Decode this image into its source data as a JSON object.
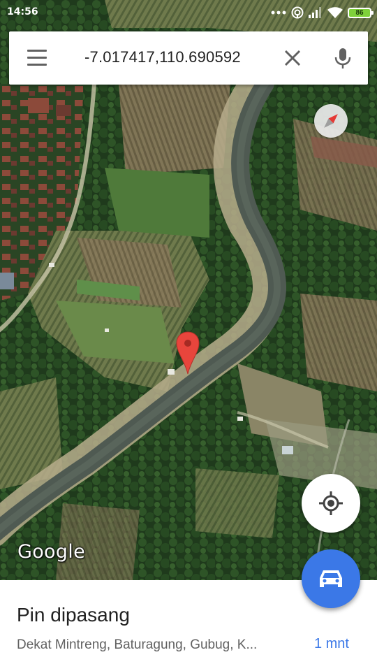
{
  "status_bar": {
    "time": "14:56",
    "battery": "86",
    "icons": [
      "more-dots-icon",
      "hotspot-icon",
      "cell-signal-icon",
      "wifi-icon",
      "battery-icon"
    ]
  },
  "search_bar": {
    "query": "-7.017417,110.690592",
    "icons": [
      "menu-icon",
      "close-icon",
      "mic-icon"
    ]
  },
  "map": {
    "attribution": "Google",
    "view": "satellite",
    "pin_color": "#e8453c",
    "river_color": "#4f5a52",
    "controls": [
      "compass-icon",
      "my-location-icon",
      "car-icon"
    ]
  },
  "place": {
    "title": "Pin dipasang",
    "address": "Dekat Mintreng, Baturagung, Gubug, K...",
    "travel_time": "1 mnt"
  },
  "colors": {
    "accent": "#3b78e7",
    "battery": "#7fd13b"
  }
}
